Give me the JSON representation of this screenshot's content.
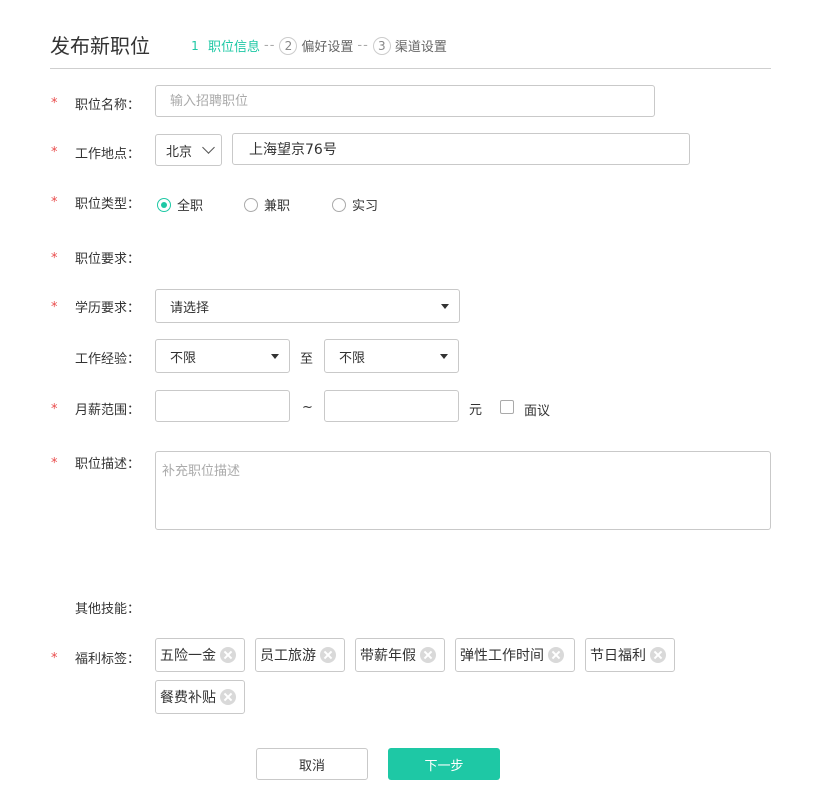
{
  "page": {
    "title": "发布新职位"
  },
  "steps": [
    {
      "num": "1",
      "label": "职位信息",
      "active": true
    },
    {
      "num": "2",
      "label": "偏好设置",
      "active": false
    },
    {
      "num": "3",
      "label": "渠道设置",
      "active": false
    }
  ],
  "step_separator": "--",
  "required_mark": "*",
  "form": {
    "job_name": {
      "label": "职位名称：",
      "placeholder": "输入招聘职位",
      "value": ""
    },
    "location": {
      "label": "工作地点：",
      "city": "北京",
      "address": "上海望京76号"
    },
    "job_type": {
      "label": "职位类型：",
      "options": [
        "全职",
        "兼职",
        "实习"
      ],
      "selected": "全职"
    },
    "requirements": {
      "label": "职位要求："
    },
    "education": {
      "label": "学历要求：",
      "value": "请选择"
    },
    "experience": {
      "label": "工作经验：",
      "from": "不限",
      "to_label": "至",
      "to": "不限"
    },
    "salary": {
      "label": "月薪范围：",
      "min": "",
      "max": "",
      "range_sep": "~",
      "unit": "元",
      "negotiable_label": "面议",
      "negotiable": false
    },
    "description": {
      "label": "职位描述：",
      "placeholder": "补充职位描述"
    },
    "skills": {
      "label": "其他技能："
    },
    "benefits": {
      "label": "福利标签：",
      "tags": [
        "五险一金",
        "员工旅游",
        "带薪年假",
        "弹性工作时间",
        "节日福利",
        "餐费补贴"
      ]
    }
  },
  "buttons": {
    "cancel": "取消",
    "next": "下一步"
  },
  "colors": {
    "accent": "#1ec8a5",
    "required": "#e94a4a",
    "border": "#c9c9c9"
  }
}
